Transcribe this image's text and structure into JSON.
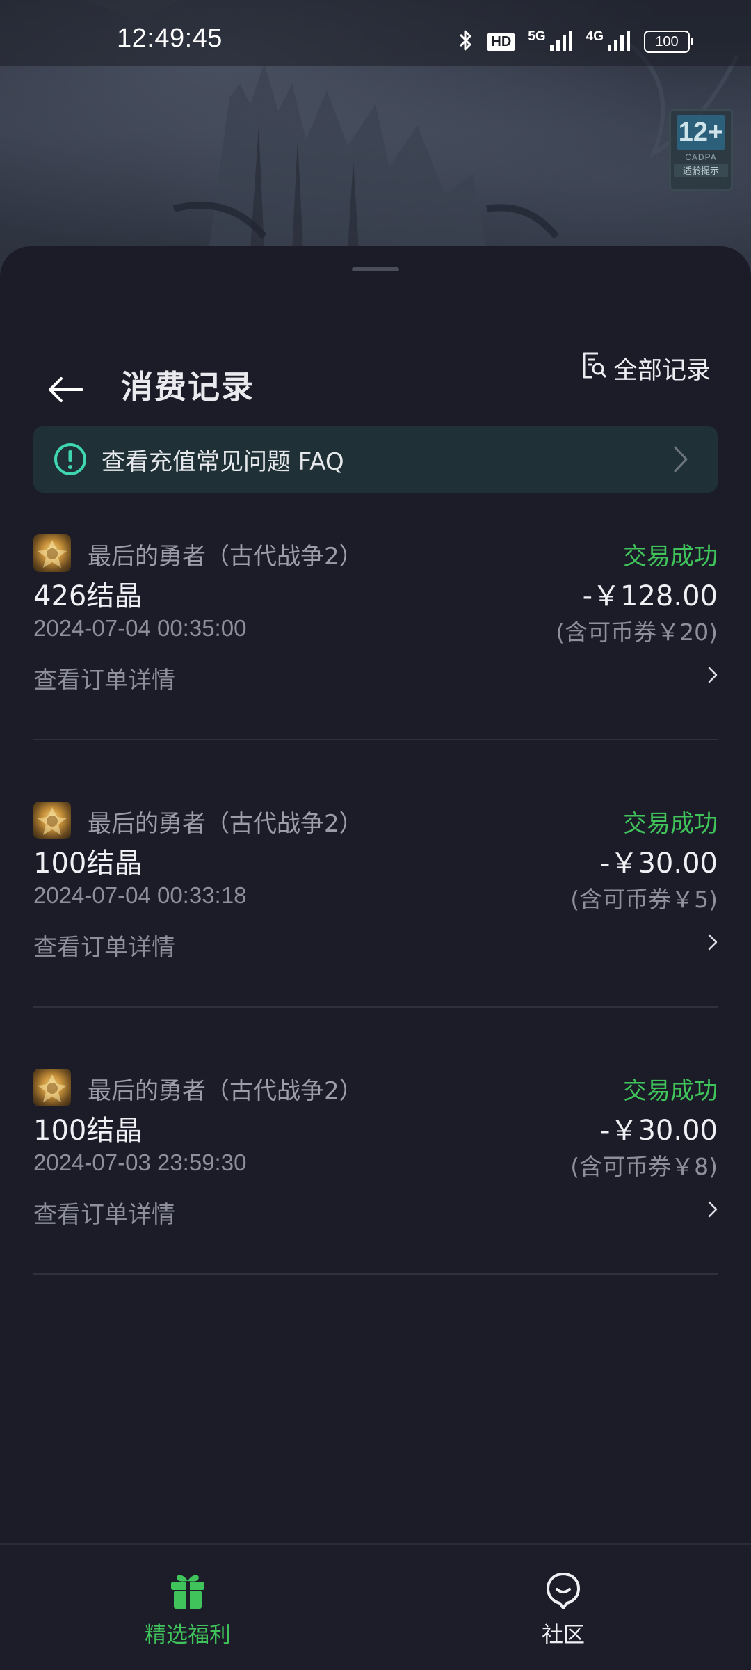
{
  "status_bar": {
    "time": "12:49:45",
    "hd": "HD",
    "net_5g": "5G",
    "net_4g": "4G",
    "battery": "100",
    "icons": [
      "bluetooth-icon",
      "signal-5g-icon",
      "signal-4g-icon",
      "battery-icon"
    ]
  },
  "age_rating": {
    "age": "12+",
    "org": "CADPA",
    "tip": "适龄提示"
  },
  "header": {
    "title": "消费记录",
    "all_records": "全部记录"
  },
  "faq": {
    "text": "查看充值常见问题 FAQ"
  },
  "records": [
    {
      "game": "最后的勇者（古代战争2）",
      "status": "交易成功",
      "item": "426结晶",
      "amount": "-￥128.00",
      "time": "2024-07-04 00:35:00",
      "coupon": "(含可币券￥20)",
      "link": "查看订单详情"
    },
    {
      "game": "最后的勇者（古代战争2）",
      "status": "交易成功",
      "item": "100结晶",
      "amount": "-￥30.00",
      "time": "2024-07-04 00:33:18",
      "coupon": "(含可币券￥5)",
      "link": "查看订单详情"
    },
    {
      "game": "最后的勇者（古代战争2）",
      "status": "交易成功",
      "item": "100结晶",
      "amount": "-￥30.00",
      "time": "2024-07-03 23:59:30",
      "coupon": "(含可币券￥8)",
      "link": "查看订单详情"
    }
  ],
  "bottom_nav": {
    "items": [
      {
        "label": "精选福利",
        "icon": "gift-icon",
        "active": true
      },
      {
        "label": "社区",
        "icon": "community-icon",
        "active": false
      }
    ]
  },
  "colors": {
    "background": "#1b1c28",
    "success_green": "#3fc35a",
    "faq_bg": "#1f3136",
    "faq_accent": "#3fd7b1"
  }
}
